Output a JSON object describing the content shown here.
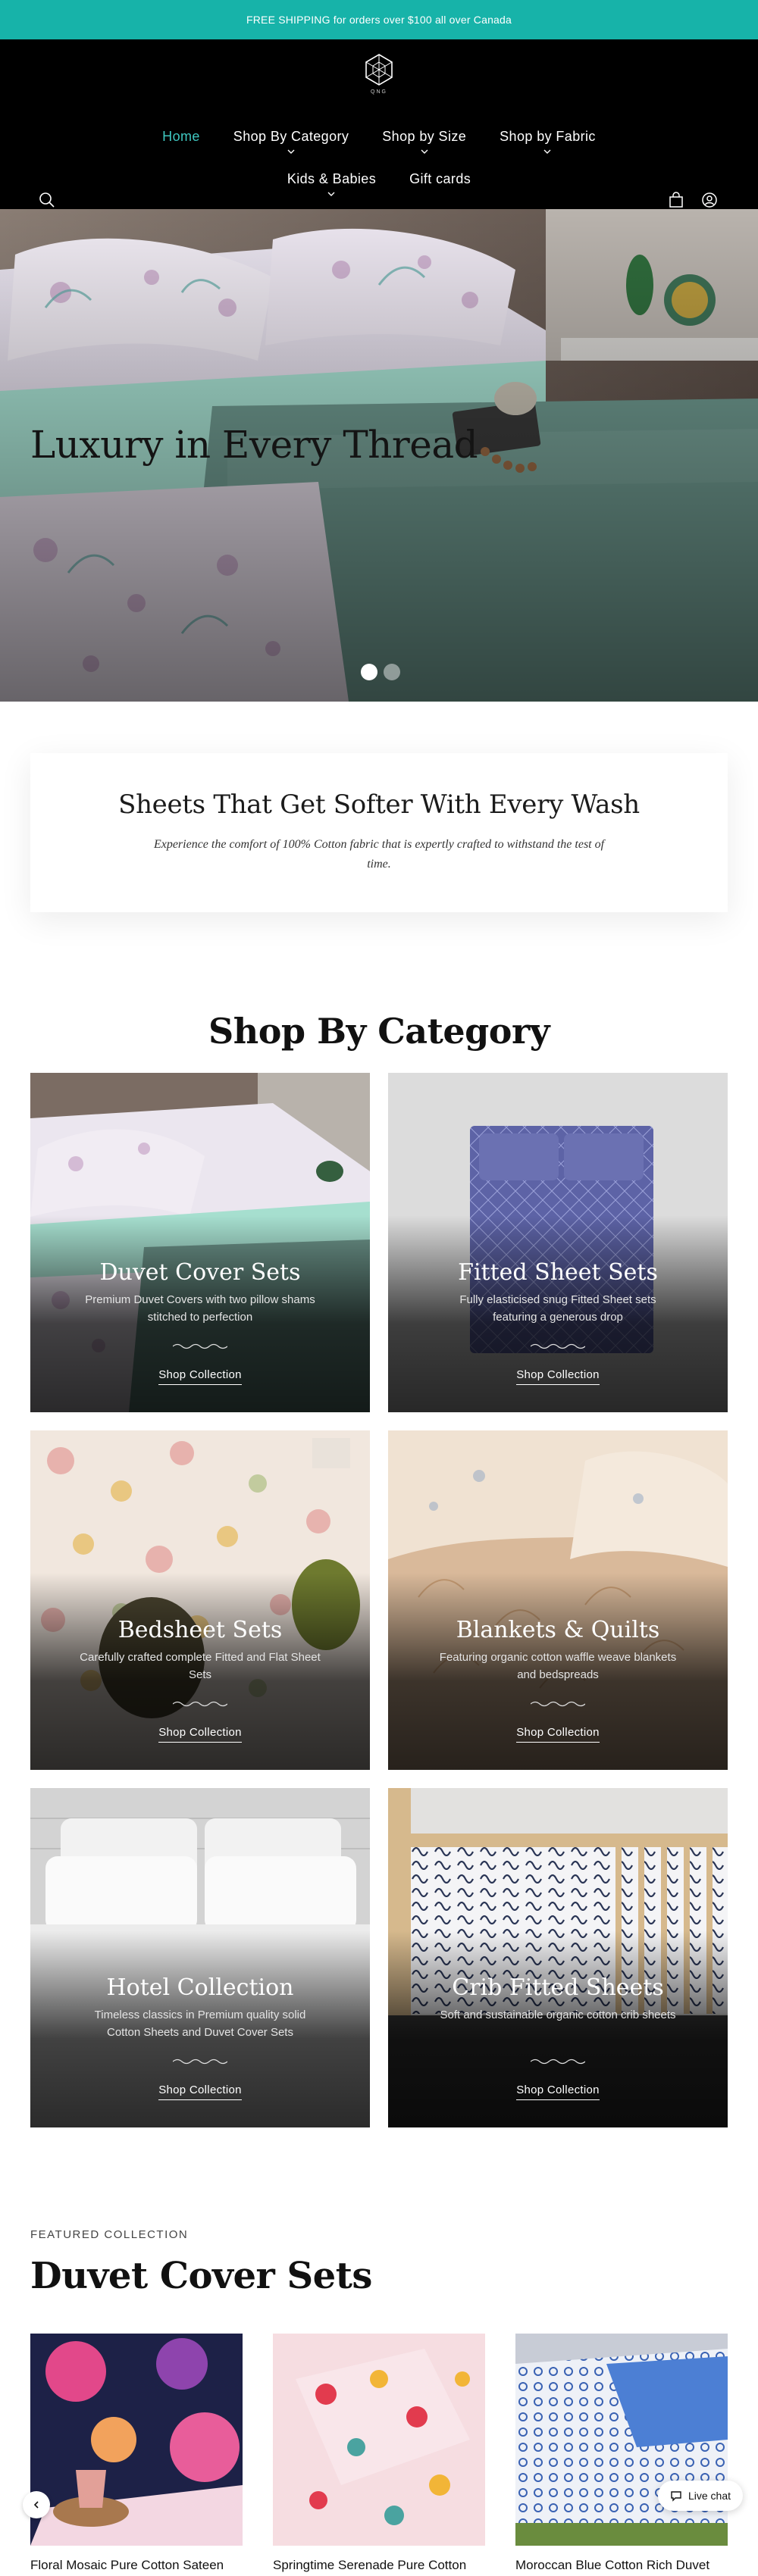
{
  "announcement": "FREE SHIPPING for orders over $100 all over Canada",
  "brand": {
    "logo_tagline": "QNG"
  },
  "nav": {
    "row1": [
      {
        "label": "Home",
        "active": true,
        "dropdown": false
      },
      {
        "label": "Shop By Category",
        "active": false,
        "dropdown": true
      },
      {
        "label": "Shop by Size",
        "active": false,
        "dropdown": true
      },
      {
        "label": "Shop by Fabric",
        "active": false,
        "dropdown": true
      }
    ],
    "row2": [
      {
        "label": "Kids & Babies",
        "active": false,
        "dropdown": true
      },
      {
        "label": "Gift cards",
        "active": false,
        "dropdown": false
      }
    ]
  },
  "header_icons": {
    "search": "search-icon",
    "cart": "bag-icon",
    "account": "user-icon"
  },
  "hero": {
    "title": "Luxury in Every Thread",
    "slides": 2,
    "active_slide": 1
  },
  "softer": {
    "heading": "Sheets That Get Softer With Every Wash",
    "text": "Experience the comfort of 100% Cotton fabric that is expertly crafted to withstand the test of time."
  },
  "categories": {
    "heading": "Shop By Category",
    "cta": "Shop Collection",
    "items": [
      {
        "title": "Duvet Cover Sets",
        "desc": "Premium Duvet Covers with two pillow shams stitched to perfection"
      },
      {
        "title": "Fitted Sheet Sets",
        "desc": "Fully elasticised snug Fitted Sheet sets featuring a generous drop"
      },
      {
        "title": "Bedsheet Sets",
        "desc": "Carefully crafted complete Fitted and Flat Sheet Sets"
      },
      {
        "title": "Blankets & Quilts",
        "desc": "Featuring organic cotton waffle weave blankets and bedspreads"
      },
      {
        "title": "Hotel Collection",
        "desc": "Timeless classics in Premium quality solid Cotton Sheets and Duvet Cover Sets"
      },
      {
        "title": "Crib Fitted Sheets",
        "desc": "Soft and sustainable organic cotton crib sheets"
      }
    ]
  },
  "featured": {
    "label": "FEATURED COLLECTION",
    "title": "Duvet Cover Sets",
    "products": [
      {
        "name": "Floral Mosaic Pure Cotton Sateen"
      },
      {
        "name": "Springtime Serenade Pure Cotton"
      },
      {
        "name": "Moroccan Blue Cotton Rich Duvet"
      }
    ]
  },
  "chat": {
    "label": "Live chat"
  },
  "colors": {
    "accent": "#17b3a9",
    "nav_active": "#3fc7c0",
    "header_bg": "#000000"
  }
}
